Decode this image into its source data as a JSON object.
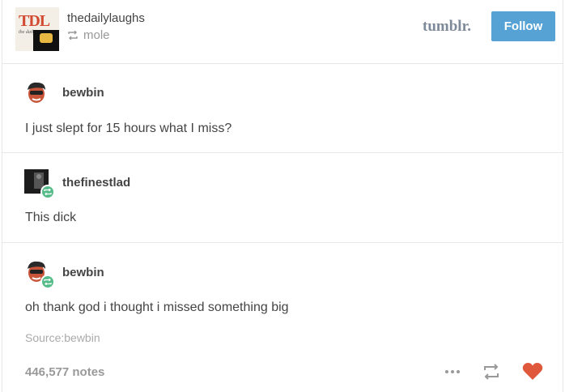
{
  "header": {
    "logo_text": "TDL",
    "logo_tagline": "the daily",
    "blog_name": "thedailylaughs",
    "reblogged_from": "mole",
    "brand": "tumblr.",
    "follow_label": "Follow"
  },
  "posts": [
    {
      "username": "bewbin",
      "text": "I just slept for 15 hours what I miss?",
      "reblog_badge": false
    },
    {
      "username": "thefinestlad",
      "text": "This dick",
      "reblog_badge": true
    },
    {
      "username": "bewbin",
      "text": "oh thank god i thought i missed something big",
      "reblog_badge": true
    }
  ],
  "footer": {
    "source": "Source:bewbin",
    "notes": "446,577 notes",
    "icons": [
      "more-icon",
      "reblog-icon",
      "like-heart-icon"
    ]
  },
  "colors": {
    "follow": "#56a2d4",
    "badge": "#56bc8a",
    "heart": "#e0583c",
    "brand": "#7d8a99"
  }
}
